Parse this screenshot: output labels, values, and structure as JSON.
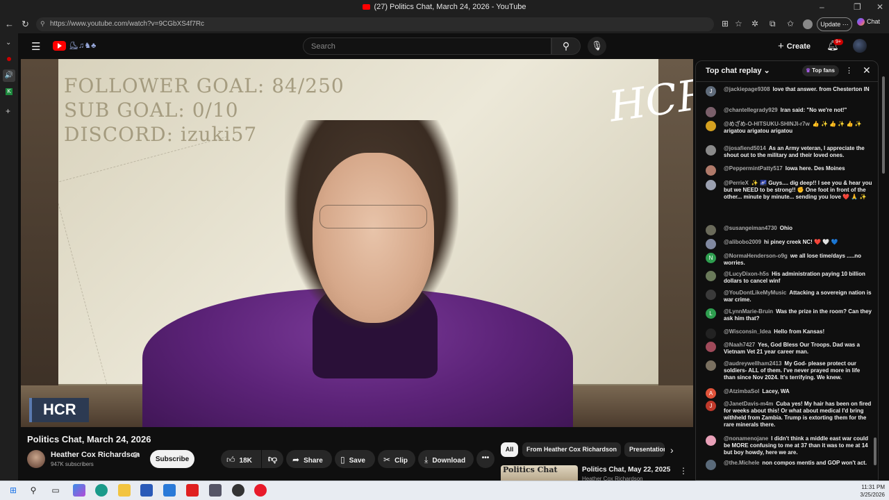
{
  "browser": {
    "window_title": "(27) Politics Chat, March 24, 2026 - YouTube",
    "url": "https://www.youtube.com/watch?v=9CGbXS4f7Rc",
    "update_label": "Update",
    "chat_label": "Chat",
    "minimize": "–",
    "maximize": "❐",
    "close": "✕"
  },
  "youtube_header": {
    "search_placeholder": "Search",
    "create_label": "Create",
    "notification_count": "9+"
  },
  "video": {
    "overlay_lines": [
      "FOLLOWER GOAL: 84/250",
      "SUB GOAL: 0/10",
      "DISCORD: izuki57"
    ],
    "watermark": "HCR",
    "lower_badge": "HCR"
  },
  "video_info": {
    "title": "Politics Chat, March 24, 2026",
    "channel_name": "Heather Cox Richardson",
    "subscribers": "947K subscribers",
    "subscribe_label": "Subscribe",
    "like_count": "18K",
    "share_label": "Share",
    "save_label": "Save",
    "clip_label": "Clip",
    "download_label": "Download"
  },
  "related": {
    "chips": [
      "All",
      "From Heather Cox Richardson",
      "Presentations"
    ],
    "item_title": "Politics Chat, May 22, 2025",
    "item_channel": "Heather Cox Richardson",
    "thumb_text": "Politics Chat"
  },
  "chat": {
    "title": "Top chat replay",
    "top_fans_label": "Top fans",
    "messages": [
      {
        "author": "@jackiepage9308",
        "text": "love that answer. from Chesterton IN",
        "avatar": "J",
        "color": "#5f6b7a"
      },
      {
        "author": "@chantellegrady929",
        "text": "Iran said: \"No we're not!\"",
        "avatar": "",
        "color": "#7a5f6a"
      },
      {
        "author": "@めざめ-O-HITSUKU-SHINJI-r7w",
        "text": "👍 ✨ 👍 ✨ 👍 ✨ arigatou arigatou arigatou",
        "avatar": "",
        "color": "#d4a020"
      },
      {
        "author": "@josafiend5014",
        "text": "As an Army veteran, I appreciate the shout out to the military and their loved ones.",
        "avatar": "",
        "color": "#8a8a8a"
      },
      {
        "author": "@PeppermintPatty517",
        "text": "Iowa here. Des Moines",
        "avatar": "",
        "color": "#b07a6a"
      },
      {
        "author": "@PerrieX",
        "text": "✨ 🌌 Guys.... dig deep!! I see you & hear you but we NEED to be strong!! ✊ One foot in front of the other... minute by minute... sending you love ❤️ 🙏 ✨",
        "avatar": "",
        "color": "#9aa0b0"
      },
      {
        "author": "@susangeiman4730",
        "text": "Ohio",
        "avatar": "",
        "color": "#6a6a5a"
      },
      {
        "author": "@alibobo2009",
        "text": "hi piney creek NC! ❤️ 🤍 💙",
        "avatar": "",
        "color": "#8088a0"
      },
      {
        "author": "@NormaHenderson-o9g",
        "text": "we all lose time/days .....no worries.",
        "avatar": "N",
        "color": "#2e9e4f"
      },
      {
        "author": "@LucyDixon-h5s",
        "text": "His administration paying 10 billion dollars to cancel winf",
        "avatar": "",
        "color": "#6a7a5a"
      },
      {
        "author": "@YouDontLikeMyMusic",
        "text": "Attacking a sovereign nation is war crime.",
        "avatar": "",
        "color": "#3a3a3a"
      },
      {
        "author": "@LynnMarie-Bruin",
        "text": "Was the prize in the room? Can they ask him that?",
        "avatar": "L",
        "color": "#2e9e4f"
      },
      {
        "author": "@Wisconsin_Idea",
        "text": "Hello from Kansas!",
        "avatar": "",
        "color": "#222222"
      },
      {
        "author": "@Naah7427",
        "text": "Yes, God Bless Our Troops. Dad was a Vietnam Vet 21 year career man.",
        "avatar": "",
        "color": "#a04a5a"
      },
      {
        "author": "@audreywellham2413",
        "text": "My God- please protect our soldiers- ALL of them. I've never prayed more in life than since Nov 2024. It's terrifying. We knew.",
        "avatar": "",
        "color": "#7a7060"
      },
      {
        "author": "@AtzimbaSol",
        "text": "Lacey, WA",
        "avatar": "A",
        "color": "#e0533a"
      },
      {
        "author": "@JanetDavis-m4m",
        "text": "Cuba yes! My hair has been on fired for weeks about this! Or what about medical I'd bring withheld from Zambia. Trump is extorting them for the rare minerals there.",
        "avatar": "J",
        "color": "#c0392b"
      },
      {
        "author": "@nonamenojane",
        "text": "I didn't think a middle east war could be MORE confusing to me at 37 than it was to me at 14 but boy howdy, here we are.",
        "avatar": "",
        "color": "#e8a0b8"
      },
      {
        "author": "@the.Michele",
        "text": "non compos mentis and GOP won't act.",
        "avatar": "",
        "color": "#5a6a7a"
      }
    ]
  },
  "taskbar": {
    "time": "11:31 PM",
    "date": "3/25/2026"
  }
}
